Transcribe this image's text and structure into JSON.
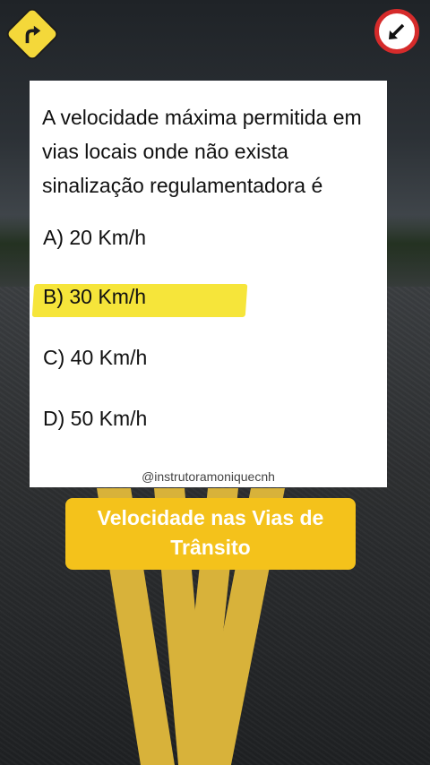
{
  "question": {
    "text": "A velocidade máxima permitida em vias locais onde não exista sinalização regulamentadora é"
  },
  "options": [
    {
      "label": "A) 20 Km/h",
      "highlighted": false
    },
    {
      "label": "B) 30 Km/h",
      "highlighted": true
    },
    {
      "label": "C) 40 Km/h",
      "highlighted": false
    },
    {
      "label": "D) 50 Km/h",
      "highlighted": false
    }
  ],
  "watermark": "@instrutoramoniquecnh",
  "caption": {
    "line1": "Velocidade nas Vias de",
    "line2": "Trânsito"
  },
  "icons": {
    "top_left": "curve-right-warning-sign-icon",
    "top_right": "arrow-down-left-regulatory-sign-icon"
  },
  "colors": {
    "highlight": "#f6e53a",
    "caption_bg": "#f4c21b",
    "road_stripe": "#d8b23a",
    "sign_red": "#d52b2b",
    "sign_yellow": "#f4d83a"
  }
}
